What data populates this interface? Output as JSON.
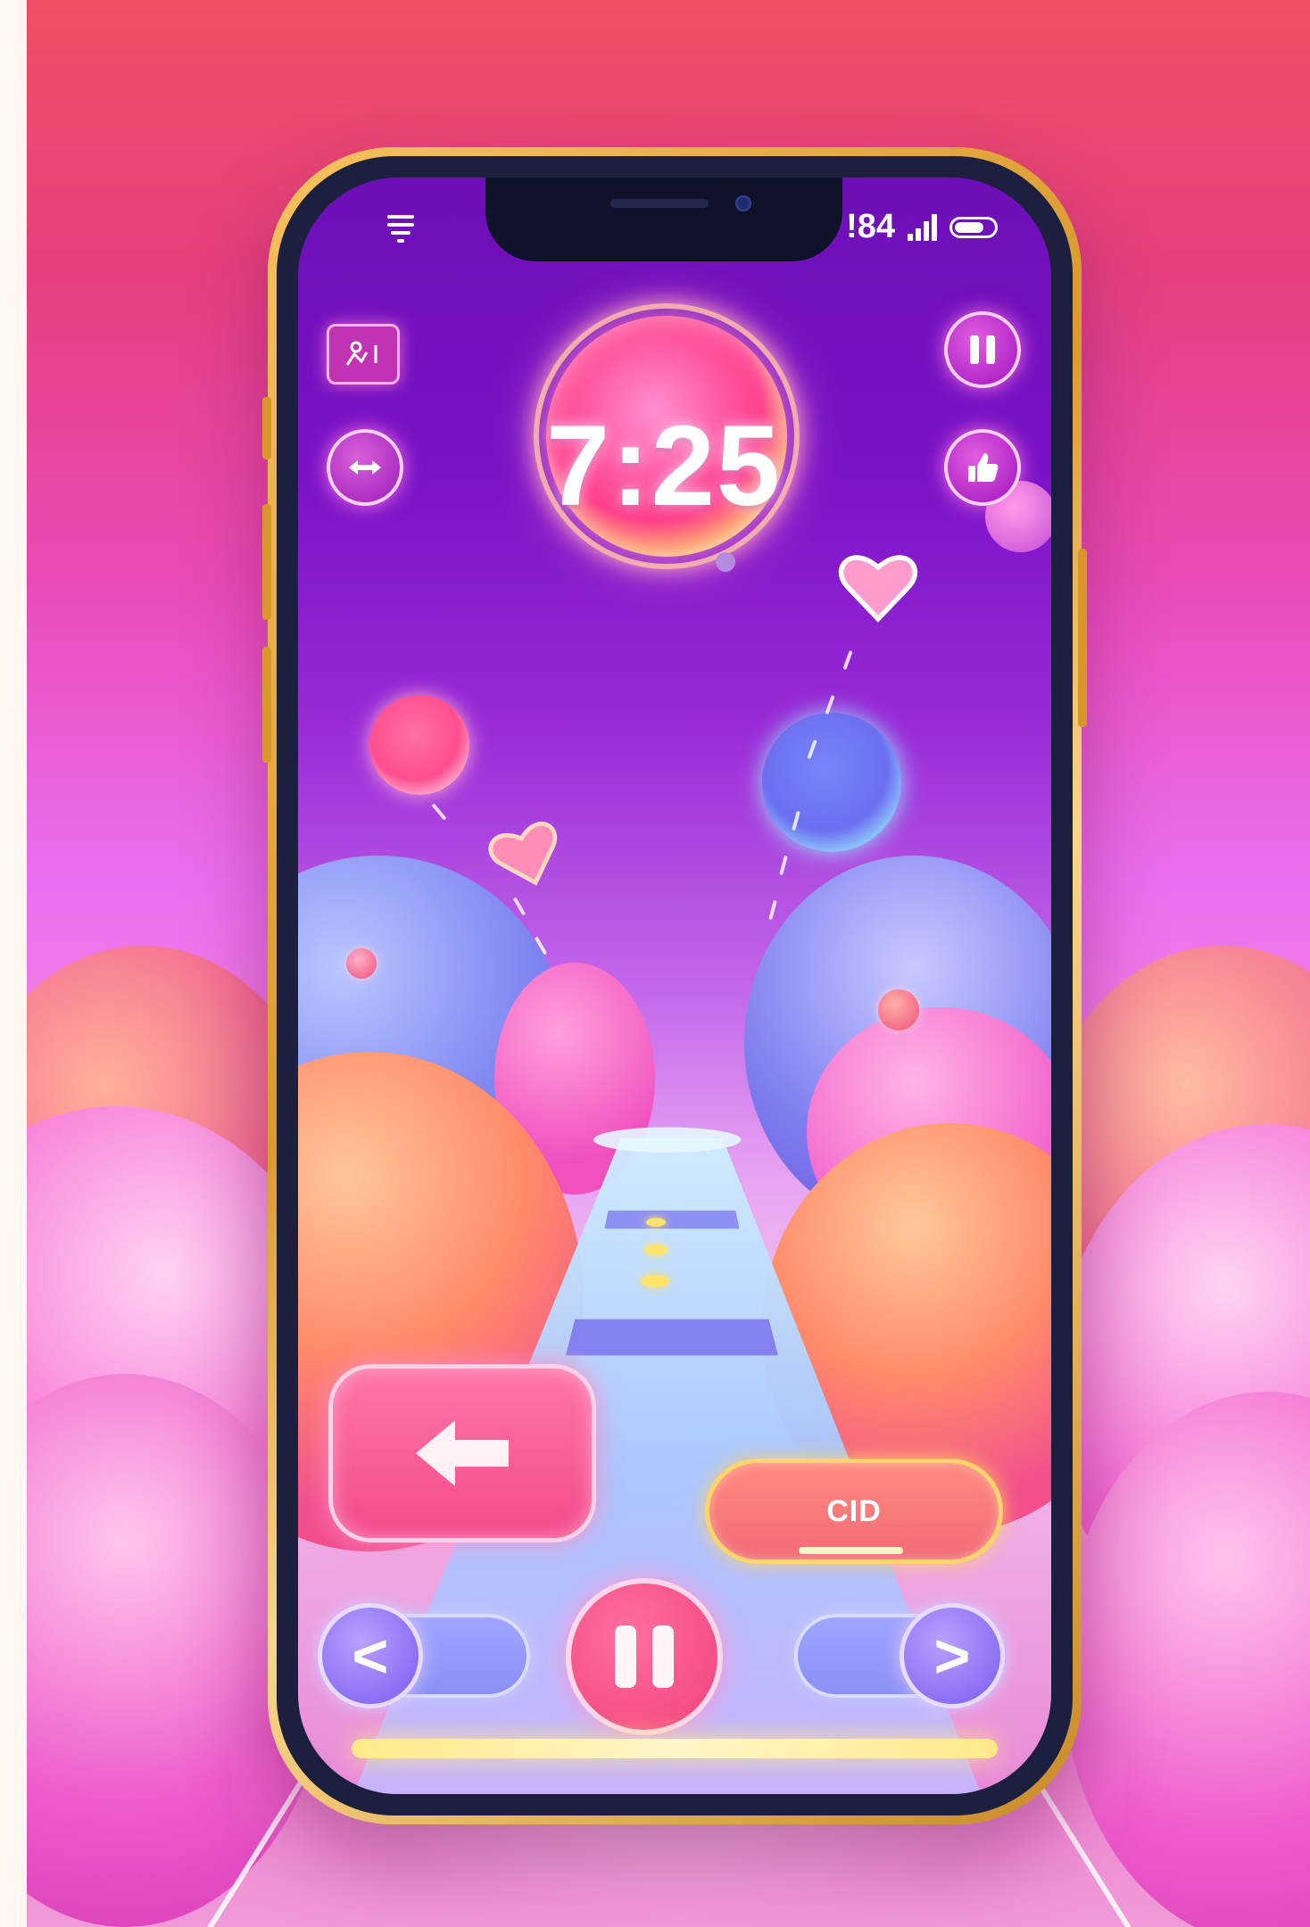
{
  "status_bar": {
    "time_fragment": "!84",
    "signal_bars": 4,
    "battery_level": 0.75
  },
  "hud": {
    "timer": "7:25",
    "top_left_icon": "player-card-icon",
    "left_icon": "swap-arrows-icon",
    "top_right_icon": "pause-icon",
    "right_icon": "thumbs-up-icon"
  },
  "controls": {
    "big_button_icon": "arrow-left-icon",
    "cid_label": "CID",
    "cid_progress": 0.45,
    "left_nav_symbol": "<",
    "right_nav_symbol": ">",
    "center_icon": "pause-icon"
  },
  "colors": {
    "accent_pink": "#f24b8a",
    "accent_purple": "#7b12c6",
    "gold_trim": "#ffd46a"
  }
}
